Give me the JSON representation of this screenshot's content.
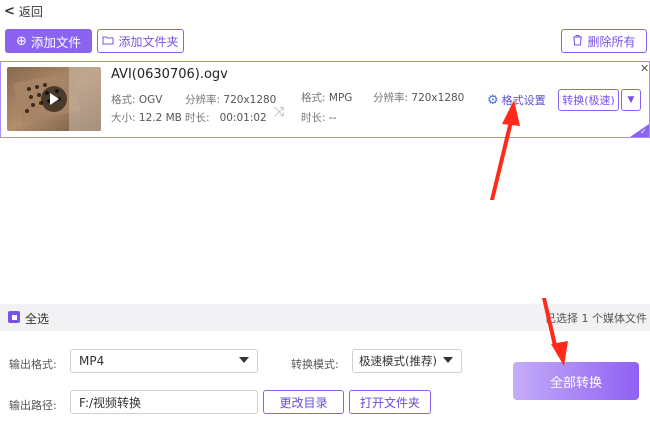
{
  "topbar": {
    "back_label": "返回"
  },
  "toolbar": {
    "add_file_label": "添加文件",
    "add_folder_label": "添加文件夹",
    "delete_all_label": "删除所有"
  },
  "file_item": {
    "name": "AVI(0630706).ogv",
    "source": {
      "format_label": "格式:",
      "format": "OGV",
      "resolution_label": "分辨率:",
      "resolution": "720x1280",
      "size_label": "大小:",
      "size": "12.2 MB",
      "duration_label": "时长:",
      "duration": "00:01:02"
    },
    "target": {
      "format_label": "格式:",
      "format": "MPG",
      "resolution_label": "分辨率:",
      "resolution": "720x1280",
      "duration_label": "时长:",
      "duration": "--"
    },
    "format_settings_label": "格式设置",
    "convert_label": "转换(极速)"
  },
  "selection": {
    "select_all_label": "全选",
    "selected_text": "已选择 1 个媒体文件"
  },
  "settings": {
    "output_format_label": "输出格式:",
    "output_format_value": "MP4",
    "convert_mode_label": "转换模式:",
    "convert_mode_value": "极速模式(推荐)",
    "output_path_label": "输出路径:",
    "output_path_value": "F:/视频转换",
    "change_dir_label": "更改目录",
    "open_folder_label": "打开文件夹",
    "convert_all_label": "全部转换"
  },
  "colors": {
    "accent": "#8a63f0",
    "annotation_arrow": "#ff2a1a"
  }
}
